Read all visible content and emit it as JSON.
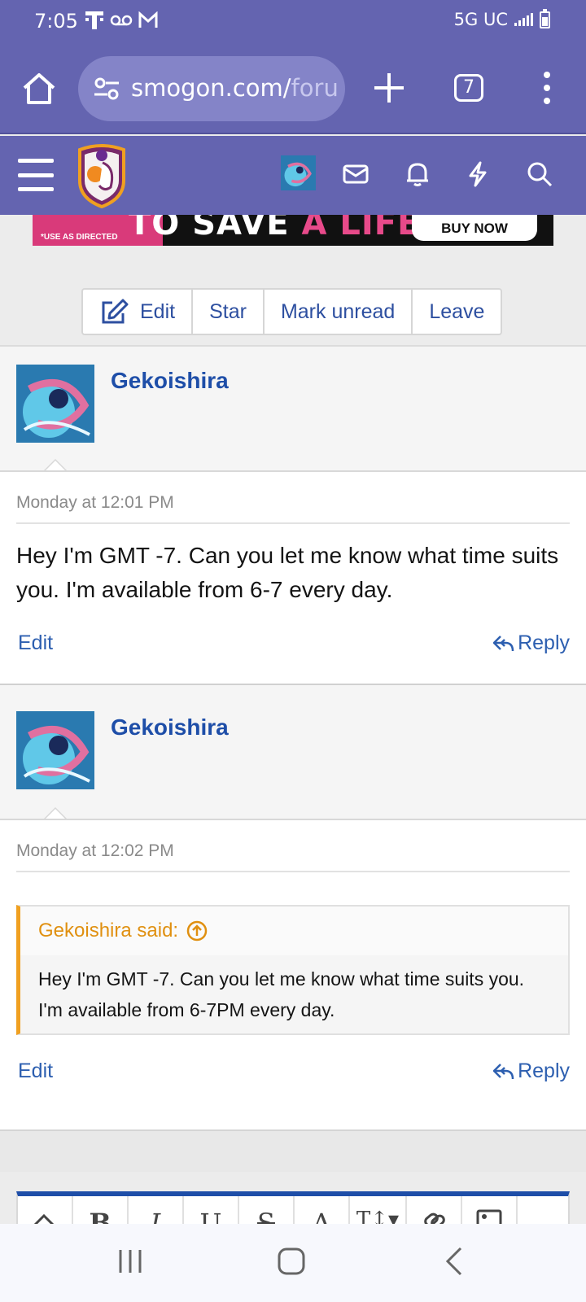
{
  "status_bar": {
    "time": "7:05",
    "network": "5G UC",
    "icons": [
      "t-mobile-icon",
      "voicemail-icon",
      "gmail-icon",
      "signal-icon",
      "battery-icon"
    ]
  },
  "browser": {
    "url_main": "smogon.com/",
    "url_fade": "foru",
    "tab_count": "7",
    "icons": [
      "home-icon",
      "site-settings-icon",
      "plus-icon",
      "tabs-icon",
      "more-icon"
    ]
  },
  "site_header": {
    "icons": [
      "menu-icon",
      "smogon-logo",
      "user-avatar",
      "mail-icon",
      "bell-icon",
      "lightning-icon",
      "search-icon"
    ]
  },
  "ad": {
    "headline_white": "TO SAVE ",
    "headline_pink": "A LIFE",
    "fine_print": "*USE AS DIRECTED",
    "cta": "BUY NOW"
  },
  "actions": {
    "edit": "Edit",
    "star": "Star",
    "mark_unread": "Mark unread",
    "leave": "Leave"
  },
  "messages": [
    {
      "author": "Gekoishira",
      "date": "Monday at 12:01 PM",
      "text": "Hey I'm GMT -7. Can you let me know what time suits you. I'm available from 6-7 every day.",
      "edit": "Edit",
      "reply": "Reply"
    },
    {
      "author": "Gekoishira",
      "date": "Monday at 12:02 PM",
      "quote_author": "Gekoishira said:",
      "quote_text": "Hey I'm GMT -7. Can you let me know what time suits you. I'm available from 6-7PM every day.",
      "edit": "Edit",
      "reply": "Reply"
    }
  ],
  "editor": {
    "tools": [
      "B",
      "I",
      "U",
      "S",
      "A",
      "T↕▾"
    ]
  },
  "colors": {
    "header": "#6464b0",
    "link": "#2d4fa0",
    "username": "#1e4ea8",
    "quote_accent": "#f0a020"
  }
}
